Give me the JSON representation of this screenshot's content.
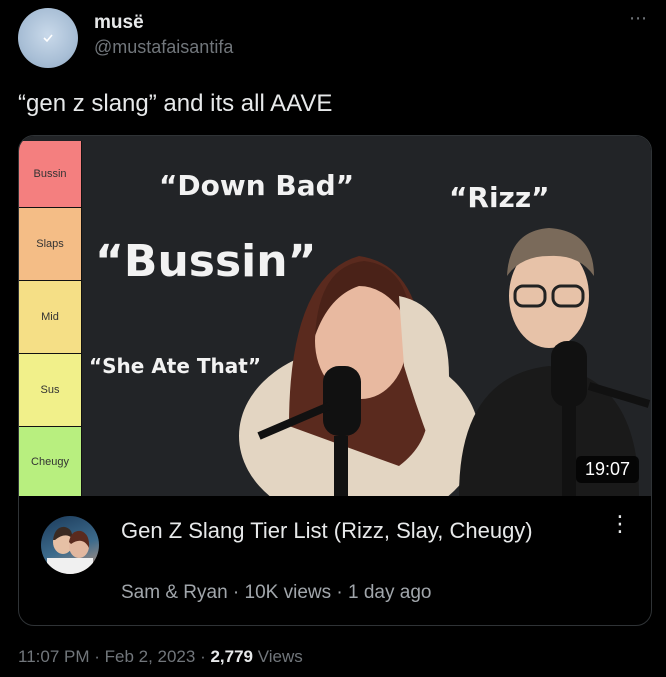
{
  "author": {
    "name": "musë",
    "handle": "@mustafaisantifa",
    "avatar_icon": "verified-check-icon"
  },
  "more_icon": "⋯",
  "tweet": {
    "text": "“gen z slang” and its all AAVE"
  },
  "video": {
    "tiers": [
      "Bussin",
      "Slaps",
      "Mid",
      "Sus",
      "Cheugy"
    ],
    "overlay_words": {
      "down_bad": "“Down Bad”",
      "rizz": "“Rizz”",
      "bussin": "“Bussin”",
      "she_ate_that": "“She Ate That”"
    },
    "duration": "19:07",
    "title": "Gen Z Slang Tier List (Rizz, Slay, Cheugy)",
    "meta": "Sam & Ryan · 10K views · 1 day ago",
    "kebab_icon": "⋮"
  },
  "footer": {
    "time": "11:07 PM · Feb 2, 2023 · ",
    "views_count": "2,779",
    "views_label": " Views"
  }
}
